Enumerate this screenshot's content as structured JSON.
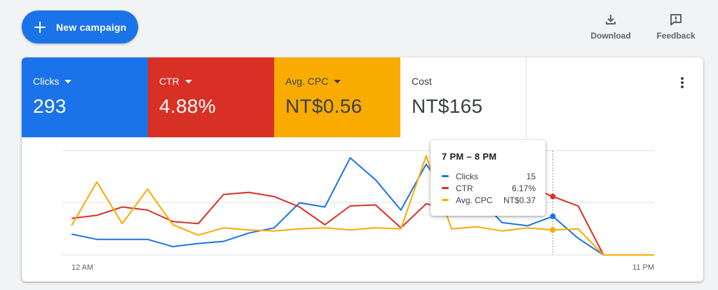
{
  "toolbar": {
    "new_campaign_label": "New campaign",
    "download_label": "Download",
    "feedback_label": "Feedback"
  },
  "metrics": [
    {
      "label": "Clicks",
      "value": "293",
      "color": "#1a73e8",
      "dropdown": true
    },
    {
      "label": "CTR",
      "value": "4.88%",
      "color": "#d93025",
      "dropdown": true
    },
    {
      "label": "Avg. CPC",
      "value": "NT$0.56",
      "color": "#f9ab00",
      "dropdown": true
    },
    {
      "label": "Cost",
      "value": "NT$165",
      "color": "#ffffff",
      "dropdown": false
    }
  ],
  "tooltip": {
    "title": "7 PM – 8 PM",
    "rows": [
      {
        "name": "Clicks",
        "value": "15",
        "color": "#1a73e8"
      },
      {
        "name": "CTR",
        "value": "6.17%",
        "color": "#d93025"
      },
      {
        "name": "Avg. CPC",
        "value": "NT$0.37",
        "color": "#f9ab00"
      }
    ]
  },
  "chart_data": {
    "type": "line",
    "x": [
      "12 AM",
      "1 AM",
      "2 AM",
      "3 AM",
      "4 AM",
      "5 AM",
      "6 AM",
      "7 AM",
      "8 AM",
      "9 AM",
      "10 AM",
      "11 AM",
      "12 PM",
      "1 PM",
      "2 PM",
      "3 PM",
      "4 PM",
      "5 PM",
      "6 PM",
      "7 PM",
      "8 PM",
      "9 PM",
      "10 PM",
      "11 PM"
    ],
    "x_tick_labels": [
      "12 AM",
      "11 PM"
    ],
    "ylim": [
      0,
      1
    ],
    "series": [
      {
        "name": "Clicks",
        "color": "#1a73e8",
        "values": [
          0.2,
          0.15,
          0.15,
          0.15,
          0.08,
          0.11,
          0.13,
          0.21,
          0.26,
          0.5,
          0.46,
          0.93,
          0.72,
          0.43,
          0.87,
          0.53,
          0.56,
          0.31,
          0.28,
          0.37,
          0.16,
          0.0,
          0.0,
          0.0
        ]
      },
      {
        "name": "CTR",
        "color": "#d93025",
        "values": [
          0.35,
          0.38,
          0.46,
          0.43,
          0.32,
          0.3,
          0.58,
          0.6,
          0.56,
          0.46,
          0.29,
          0.47,
          0.48,
          0.26,
          0.49,
          0.44,
          0.6,
          0.63,
          0.66,
          0.56,
          0.47,
          0.0,
          0.0,
          0.0
        ]
      },
      {
        "name": "Avg. CPC",
        "color": "#f9ab00",
        "values": [
          0.28,
          0.7,
          0.3,
          0.63,
          0.29,
          0.19,
          0.26,
          0.24,
          0.23,
          0.25,
          0.26,
          0.24,
          0.26,
          0.25,
          0.95,
          0.25,
          0.27,
          0.23,
          0.26,
          0.24,
          0.25,
          0.0,
          0.0,
          0.0
        ]
      }
    ],
    "grid": true
  }
}
